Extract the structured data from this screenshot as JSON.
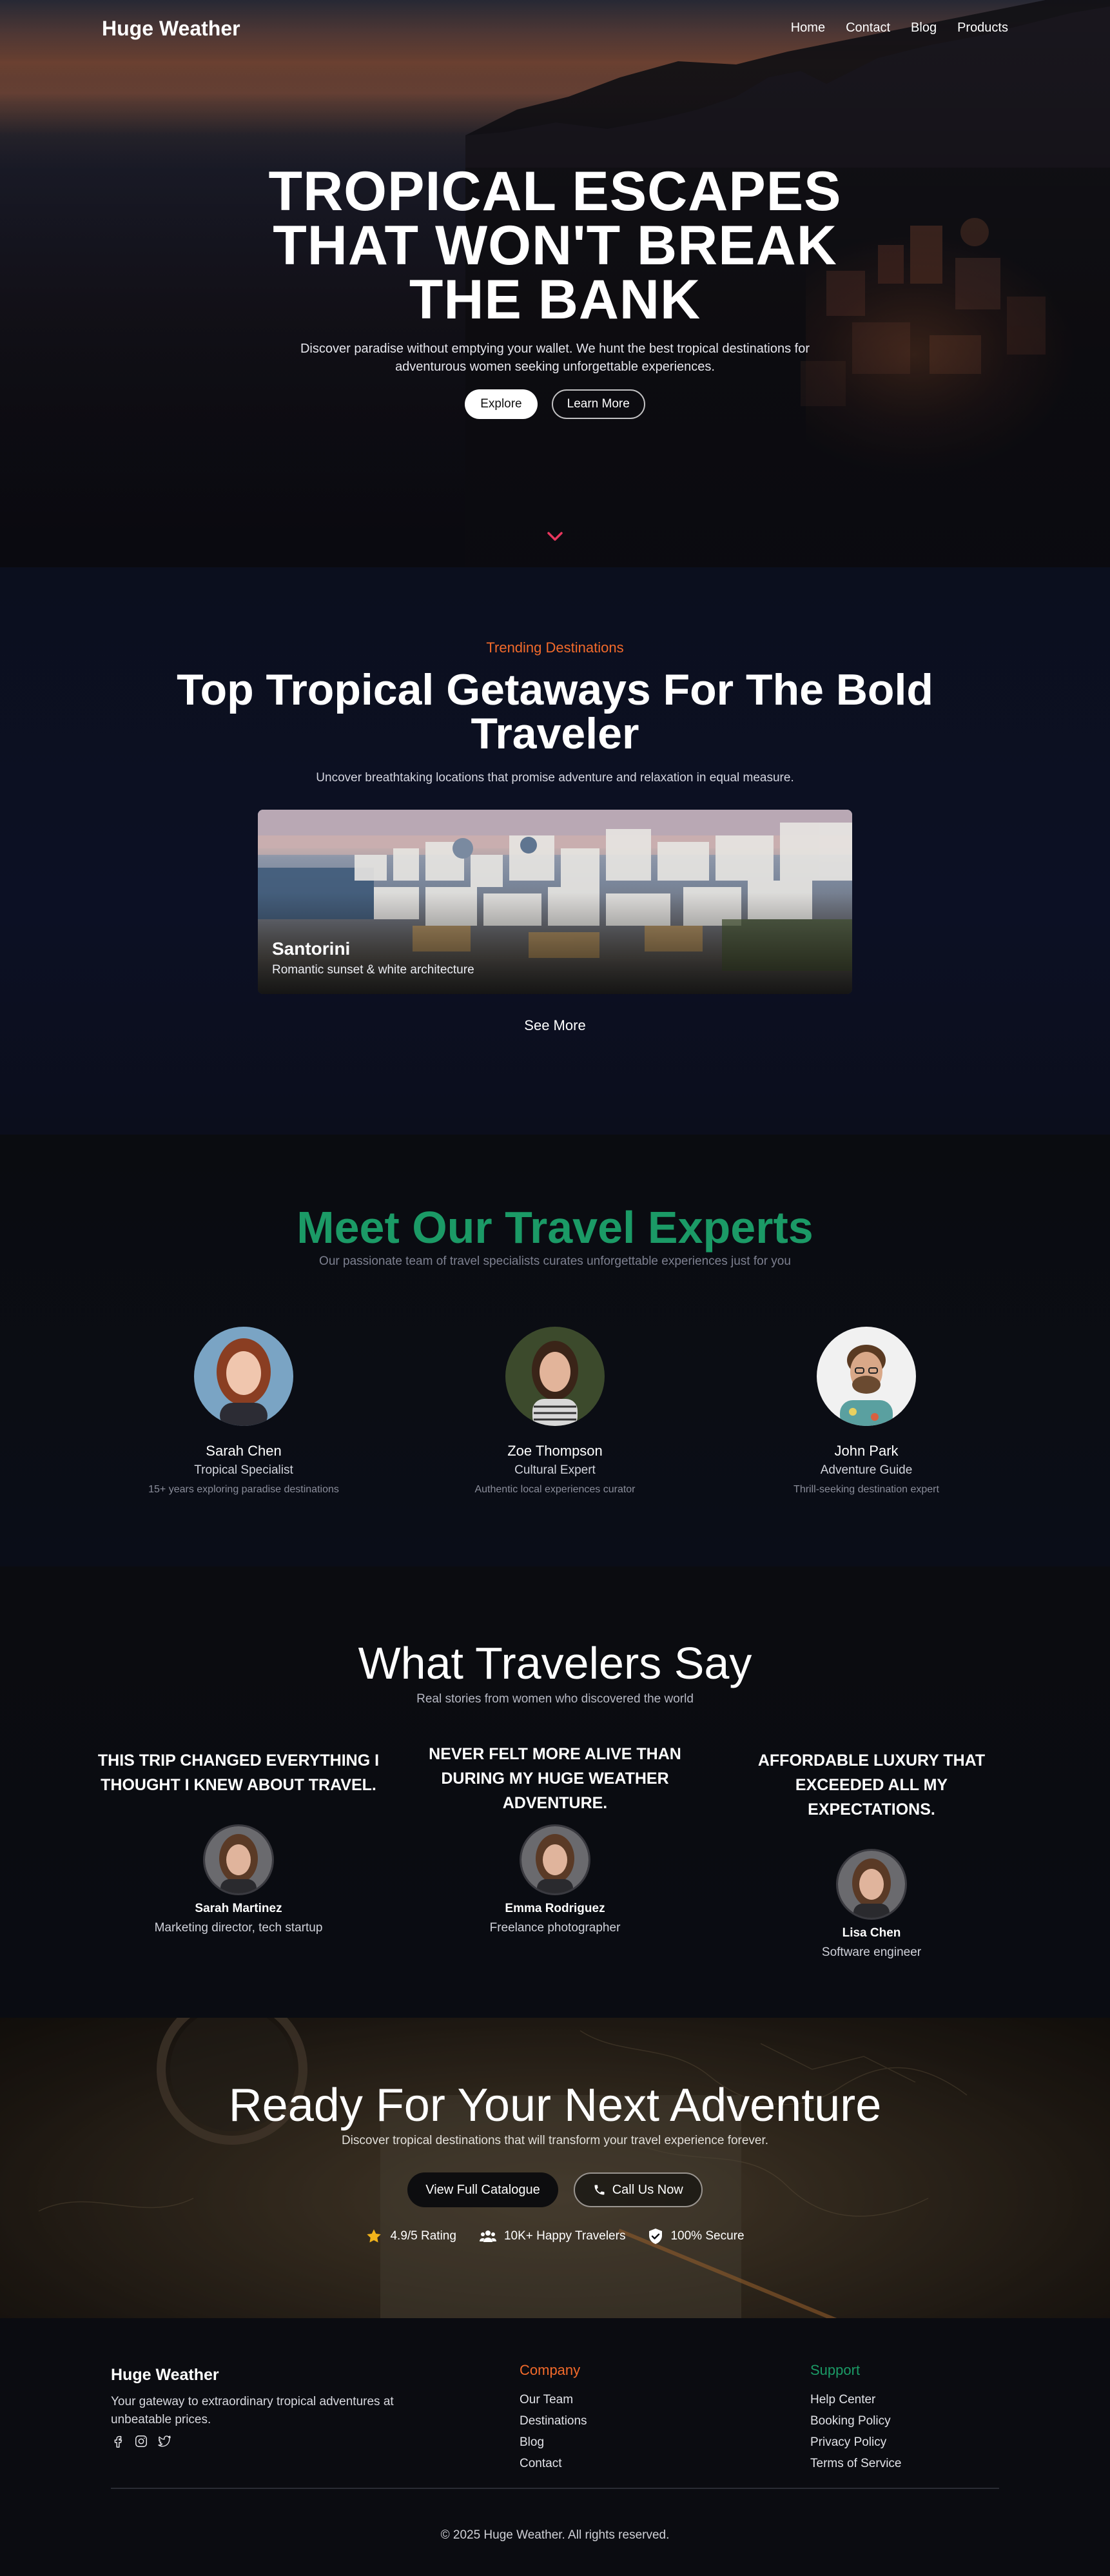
{
  "nav": {
    "brand": "Huge Weather",
    "links": [
      "Home",
      "Contact",
      "Blog",
      "Products"
    ]
  },
  "hero": {
    "title_lines": [
      "TROPICAL ESCAPES",
      "THAT WON'T BREAK",
      "THE BANK"
    ],
    "subtitle": "Discover paradise without emptying your wallet. We hunt the best tropical destinations for adventurous women seeking unforgettable experiences.",
    "primary_button": "Explore",
    "secondary_button": "Learn More",
    "scroll_icon": "chevron-down-icon"
  },
  "trending": {
    "eyebrow": "Trending Destinations",
    "title": "Top Tropical Getaways For The Bold Traveler",
    "subtitle": "Uncover breathtaking locations that promise adventure and relaxation in equal measure.",
    "card": {
      "name": "Santorini",
      "description": "Romantic sunset & white architecture"
    },
    "see_more": "See More"
  },
  "experts": {
    "title": "Meet Our Travel Experts",
    "subtitle": "Our passionate team of travel specialists curates unforgettable experiences just for you",
    "people": [
      {
        "name": "Sarah Chen",
        "role": "Tropical Specialist",
        "bio": "15+ years exploring paradise destinations"
      },
      {
        "name": "Zoe Thompson",
        "role": "Cultural Expert",
        "bio": "Authentic local experiences curator"
      },
      {
        "name": "John Park",
        "role": "Adventure Guide",
        "bio": "Thrill-seeking destination expert"
      }
    ]
  },
  "testimonials": {
    "title": "What Travelers Say",
    "subtitle": "Real stories from women who discovered the world",
    "items": [
      {
        "quote": "This trip changed everything I thought I knew about travel.",
        "name": "Sarah Martinez",
        "role": "Marketing director, tech startup"
      },
      {
        "quote": "Never felt more alive than during my Huge Weather adventure.",
        "name": "Emma Rodriguez",
        "role": "Freelance photographer"
      },
      {
        "quote": "Affordable luxury that exceeded all my expectations.",
        "name": "Lisa Chen",
        "role": "Software engineer"
      }
    ]
  },
  "cta": {
    "title": "Ready For Your Next Adventure",
    "subtitle": "Discover tropical destinations that will transform your travel experience forever.",
    "primary_button": "View Full Catalogue",
    "secondary_button": "Call Us Now",
    "stats": [
      {
        "icon": "star-icon",
        "label": "4.9/5 Rating"
      },
      {
        "icon": "users-icon",
        "label": "10K+ Happy Travelers"
      },
      {
        "icon": "shield-check-icon",
        "label": "100% Secure"
      }
    ]
  },
  "footer": {
    "brand": "Huge Weather",
    "tagline": "Your gateway to extraordinary tropical adventures at unbeatable prices.",
    "social_icons": [
      "facebook-icon",
      "instagram-icon",
      "twitter-icon"
    ],
    "company": {
      "heading": "Company",
      "links": [
        "Our Team",
        "Destinations",
        "Blog",
        "Contact"
      ]
    },
    "support": {
      "heading": "Support",
      "links": [
        "Help Center",
        "Booking Policy",
        "Privacy Policy",
        "Terms of Service"
      ]
    },
    "copyright": "© 2025 Huge Weather. All rights reserved."
  },
  "colors": {
    "accent_orange": "#f26a2b",
    "accent_green": "#1b9a66",
    "star_gold": "#f2b41b"
  }
}
